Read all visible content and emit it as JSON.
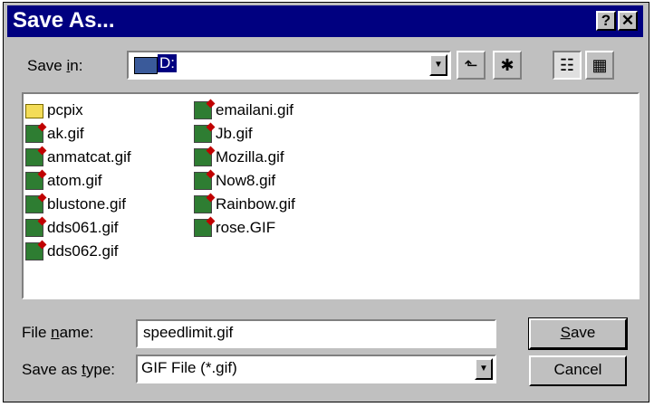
{
  "window": {
    "title": "Save As...",
    "help_label": "?",
    "close_label": "✕"
  },
  "save_in": {
    "label_prefix": "Save ",
    "label_accel": "i",
    "label_suffix": "n:",
    "value": "D:"
  },
  "toolbar": {
    "up_icon": "up-folder-icon",
    "new_folder_icon": "new-folder-icon",
    "list_icon": "list-view-icon",
    "details_icon": "details-view-icon"
  },
  "files": [
    {
      "name": "pcpix",
      "type": "folder"
    },
    {
      "name": "ak.gif",
      "type": "gif"
    },
    {
      "name": "anmatcat.gif",
      "type": "gif"
    },
    {
      "name": "atom.gif",
      "type": "gif"
    },
    {
      "name": "blustone.gif",
      "type": "gif"
    },
    {
      "name": "dds061.gif",
      "type": "gif"
    },
    {
      "name": "dds062.gif",
      "type": "gif"
    },
    {
      "name": "emailani.gif",
      "type": "gif"
    },
    {
      "name": "Jb.gif",
      "type": "gif"
    },
    {
      "name": "Mozilla.gif",
      "type": "gif"
    },
    {
      "name": "Now8.gif",
      "type": "gif"
    },
    {
      "name": "Rainbow.gif",
      "type": "gif"
    },
    {
      "name": "rose.GIF",
      "type": "gif"
    }
  ],
  "file_name": {
    "label_prefix": "File ",
    "label_accel": "n",
    "label_suffix": "ame:",
    "value": "speedlimit.gif"
  },
  "save_type": {
    "label_prefix": "Save as ",
    "label_accel": "t",
    "label_suffix": "ype:",
    "value": "GIF File (*.gif)"
  },
  "buttons": {
    "save_accel": "S",
    "save_rest": "ave",
    "cancel": "Cancel"
  },
  "colors": {
    "titlebar": "#000080",
    "face": "#c0c0c0"
  }
}
